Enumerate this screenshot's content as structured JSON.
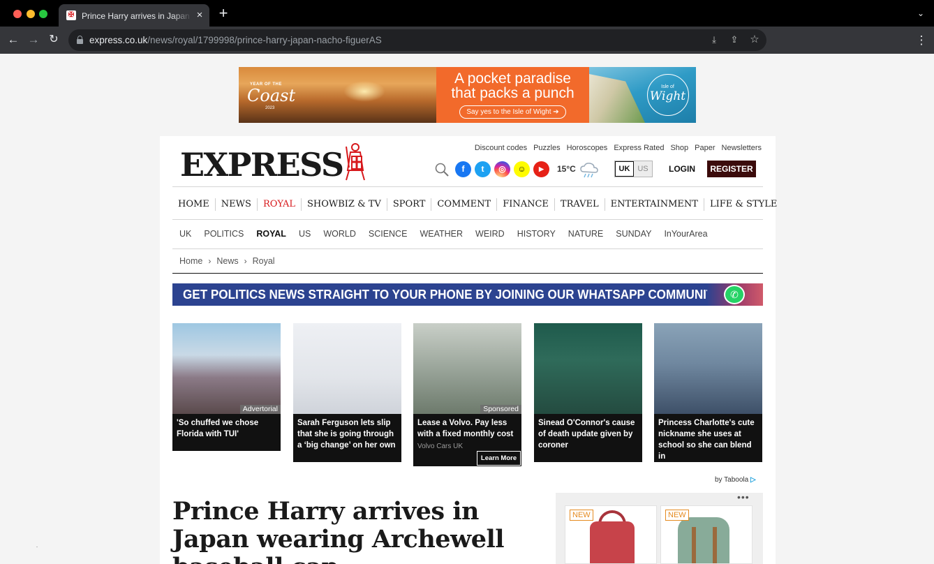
{
  "browser": {
    "tab_title": "Prince Harry arrives in Japan wearing Archewell baseball cap",
    "tab_close": "×",
    "new_tab": "+",
    "url_domain": "express.co.uk",
    "url_path": "/news/royal/1799998/prince-harry-japan-nacho-figuerAS",
    "icons": [
      "back-icon",
      "forward-icon",
      "reload-icon",
      "lock-icon",
      "install-icon",
      "share-icon",
      "bookmark-star-icon",
      "menu-kebab-icon"
    ]
  },
  "ad_banner": {
    "year_of_the": "YEAR OF THE",
    "coast": "Coast",
    "year": "2023",
    "headline_1": "A pocket paradise",
    "headline_2": "that packs a punch",
    "cta": "Say yes to the Isle of Wight ➔",
    "isle_of": "Isle of",
    "wight": "Wight",
    "colors": {
      "orange": "#f26a2b"
    }
  },
  "header": {
    "logo": "EXPRESS",
    "top_links": [
      "Discount codes",
      "Puzzles",
      "Horoscopes",
      "Express Rated",
      "Shop",
      "Paper",
      "Newsletters"
    ],
    "social": [
      "facebook-icon",
      "twitter-icon",
      "instagram-icon",
      "snapchat-icon",
      "youtube-icon"
    ],
    "temperature": "15°C",
    "edition_uk": "UK",
    "edition_us": "US",
    "login": "LOGIN",
    "register": "REGISTER",
    "colors": {
      "register_bg": "#3b0b0b",
      "accent": "#d7191c"
    }
  },
  "main_nav": [
    "HOME",
    "NEWS",
    "ROYAL",
    "SHOWBIZ & TV",
    "SPORT",
    "COMMENT",
    "FINANCE",
    "TRAVEL",
    "ENTERTAINMENT",
    "LIFE & STYLE"
  ],
  "main_nav_active": "ROYAL",
  "sub_nav": [
    "UK",
    "POLITICS",
    "ROYAL",
    "US",
    "WORLD",
    "SCIENCE",
    "WEATHER",
    "WEIRD",
    "HISTORY",
    "NATURE",
    "SUNDAY",
    "InYourArea"
  ],
  "sub_nav_active": "ROYAL",
  "breadcrumb": {
    "items": [
      "Home",
      "News",
      "Royal"
    ],
    "separator": "›"
  },
  "whatsapp_banner": {
    "text": "GET POLITICS NEWS STRAIGHT TO YOUR PHONE BY JOINING OUR WHATSAPP COMMUNITY",
    "bg": "#2c4390"
  },
  "cards": [
    {
      "title": "'So chuffed we chose Florida with TUI'",
      "label": "Advertorial"
    },
    {
      "title": "Sarah Ferguson lets slip that she is going through a ‘big change’ on her own",
      "label": ""
    },
    {
      "title": "Lease a Volvo. Pay less with a fixed monthly cost",
      "label": "Sponsored",
      "sponsor": "Volvo Cars UK",
      "cta": "Learn More"
    },
    {
      "title": "Sinead O'Connor's cause of death update given by coroner",
      "label": ""
    },
    {
      "title": "Princess Charlotte's cute nickname she uses at school so she can blend in",
      "label": ""
    }
  ],
  "taboola": {
    "by": "by",
    "brand": "Taboola"
  },
  "article": {
    "headline": "Prince Harry arrives in Japan wearing Archewell baseball cap"
  },
  "side_ad": {
    "new_badge": "NEW",
    "dots": "•••",
    "adchoices": "▷ ✕"
  }
}
